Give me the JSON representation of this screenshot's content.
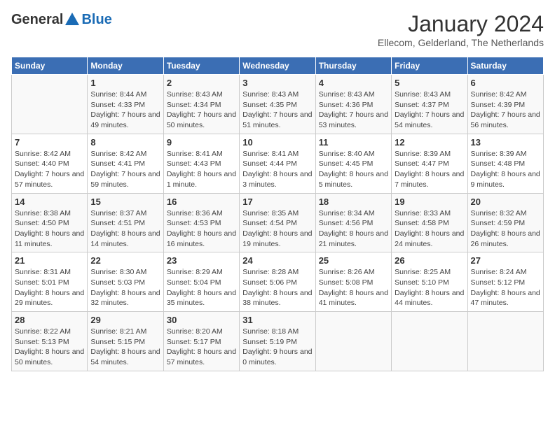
{
  "header": {
    "logo_general": "General",
    "logo_blue": "Blue",
    "month_year": "January 2024",
    "location": "Ellecom, Gelderland, The Netherlands"
  },
  "weekdays": [
    "Sunday",
    "Monday",
    "Tuesday",
    "Wednesday",
    "Thursday",
    "Friday",
    "Saturday"
  ],
  "weeks": [
    [
      {
        "day": "",
        "sunrise": "",
        "sunset": "",
        "daylight": ""
      },
      {
        "day": "1",
        "sunrise": "Sunrise: 8:44 AM",
        "sunset": "Sunset: 4:33 PM",
        "daylight": "Daylight: 7 hours and 49 minutes."
      },
      {
        "day": "2",
        "sunrise": "Sunrise: 8:43 AM",
        "sunset": "Sunset: 4:34 PM",
        "daylight": "Daylight: 7 hours and 50 minutes."
      },
      {
        "day": "3",
        "sunrise": "Sunrise: 8:43 AM",
        "sunset": "Sunset: 4:35 PM",
        "daylight": "Daylight: 7 hours and 51 minutes."
      },
      {
        "day": "4",
        "sunrise": "Sunrise: 8:43 AM",
        "sunset": "Sunset: 4:36 PM",
        "daylight": "Daylight: 7 hours and 53 minutes."
      },
      {
        "day": "5",
        "sunrise": "Sunrise: 8:43 AM",
        "sunset": "Sunset: 4:37 PM",
        "daylight": "Daylight: 7 hours and 54 minutes."
      },
      {
        "day": "6",
        "sunrise": "Sunrise: 8:42 AM",
        "sunset": "Sunset: 4:39 PM",
        "daylight": "Daylight: 7 hours and 56 minutes."
      }
    ],
    [
      {
        "day": "7",
        "sunrise": "Sunrise: 8:42 AM",
        "sunset": "Sunset: 4:40 PM",
        "daylight": "Daylight: 7 hours and 57 minutes."
      },
      {
        "day": "8",
        "sunrise": "Sunrise: 8:42 AM",
        "sunset": "Sunset: 4:41 PM",
        "daylight": "Daylight: 7 hours and 59 minutes."
      },
      {
        "day": "9",
        "sunrise": "Sunrise: 8:41 AM",
        "sunset": "Sunset: 4:43 PM",
        "daylight": "Daylight: 8 hours and 1 minute."
      },
      {
        "day": "10",
        "sunrise": "Sunrise: 8:41 AM",
        "sunset": "Sunset: 4:44 PM",
        "daylight": "Daylight: 8 hours and 3 minutes."
      },
      {
        "day": "11",
        "sunrise": "Sunrise: 8:40 AM",
        "sunset": "Sunset: 4:45 PM",
        "daylight": "Daylight: 8 hours and 5 minutes."
      },
      {
        "day": "12",
        "sunrise": "Sunrise: 8:39 AM",
        "sunset": "Sunset: 4:47 PM",
        "daylight": "Daylight: 8 hours and 7 minutes."
      },
      {
        "day": "13",
        "sunrise": "Sunrise: 8:39 AM",
        "sunset": "Sunset: 4:48 PM",
        "daylight": "Daylight: 8 hours and 9 minutes."
      }
    ],
    [
      {
        "day": "14",
        "sunrise": "Sunrise: 8:38 AM",
        "sunset": "Sunset: 4:50 PM",
        "daylight": "Daylight: 8 hours and 11 minutes."
      },
      {
        "day": "15",
        "sunrise": "Sunrise: 8:37 AM",
        "sunset": "Sunset: 4:51 PM",
        "daylight": "Daylight: 8 hours and 14 minutes."
      },
      {
        "day": "16",
        "sunrise": "Sunrise: 8:36 AM",
        "sunset": "Sunset: 4:53 PM",
        "daylight": "Daylight: 8 hours and 16 minutes."
      },
      {
        "day": "17",
        "sunrise": "Sunrise: 8:35 AM",
        "sunset": "Sunset: 4:54 PM",
        "daylight": "Daylight: 8 hours and 19 minutes."
      },
      {
        "day": "18",
        "sunrise": "Sunrise: 8:34 AM",
        "sunset": "Sunset: 4:56 PM",
        "daylight": "Daylight: 8 hours and 21 minutes."
      },
      {
        "day": "19",
        "sunrise": "Sunrise: 8:33 AM",
        "sunset": "Sunset: 4:58 PM",
        "daylight": "Daylight: 8 hours and 24 minutes."
      },
      {
        "day": "20",
        "sunrise": "Sunrise: 8:32 AM",
        "sunset": "Sunset: 4:59 PM",
        "daylight": "Daylight: 8 hours and 26 minutes."
      }
    ],
    [
      {
        "day": "21",
        "sunrise": "Sunrise: 8:31 AM",
        "sunset": "Sunset: 5:01 PM",
        "daylight": "Daylight: 8 hours and 29 minutes."
      },
      {
        "day": "22",
        "sunrise": "Sunrise: 8:30 AM",
        "sunset": "Sunset: 5:03 PM",
        "daylight": "Daylight: 8 hours and 32 minutes."
      },
      {
        "day": "23",
        "sunrise": "Sunrise: 8:29 AM",
        "sunset": "Sunset: 5:04 PM",
        "daylight": "Daylight: 8 hours and 35 minutes."
      },
      {
        "day": "24",
        "sunrise": "Sunrise: 8:28 AM",
        "sunset": "Sunset: 5:06 PM",
        "daylight": "Daylight: 8 hours and 38 minutes."
      },
      {
        "day": "25",
        "sunrise": "Sunrise: 8:26 AM",
        "sunset": "Sunset: 5:08 PM",
        "daylight": "Daylight: 8 hours and 41 minutes."
      },
      {
        "day": "26",
        "sunrise": "Sunrise: 8:25 AM",
        "sunset": "Sunset: 5:10 PM",
        "daylight": "Daylight: 8 hours and 44 minutes."
      },
      {
        "day": "27",
        "sunrise": "Sunrise: 8:24 AM",
        "sunset": "Sunset: 5:12 PM",
        "daylight": "Daylight: 8 hours and 47 minutes."
      }
    ],
    [
      {
        "day": "28",
        "sunrise": "Sunrise: 8:22 AM",
        "sunset": "Sunset: 5:13 PM",
        "daylight": "Daylight: 8 hours and 50 minutes."
      },
      {
        "day": "29",
        "sunrise": "Sunrise: 8:21 AM",
        "sunset": "Sunset: 5:15 PM",
        "daylight": "Daylight: 8 hours and 54 minutes."
      },
      {
        "day": "30",
        "sunrise": "Sunrise: 8:20 AM",
        "sunset": "Sunset: 5:17 PM",
        "daylight": "Daylight: 8 hours and 57 minutes."
      },
      {
        "day": "31",
        "sunrise": "Sunrise: 8:18 AM",
        "sunset": "Sunset: 5:19 PM",
        "daylight": "Daylight: 9 hours and 0 minutes."
      },
      {
        "day": "",
        "sunrise": "",
        "sunset": "",
        "daylight": ""
      },
      {
        "day": "",
        "sunrise": "",
        "sunset": "",
        "daylight": ""
      },
      {
        "day": "",
        "sunrise": "",
        "sunset": "",
        "daylight": ""
      }
    ]
  ]
}
